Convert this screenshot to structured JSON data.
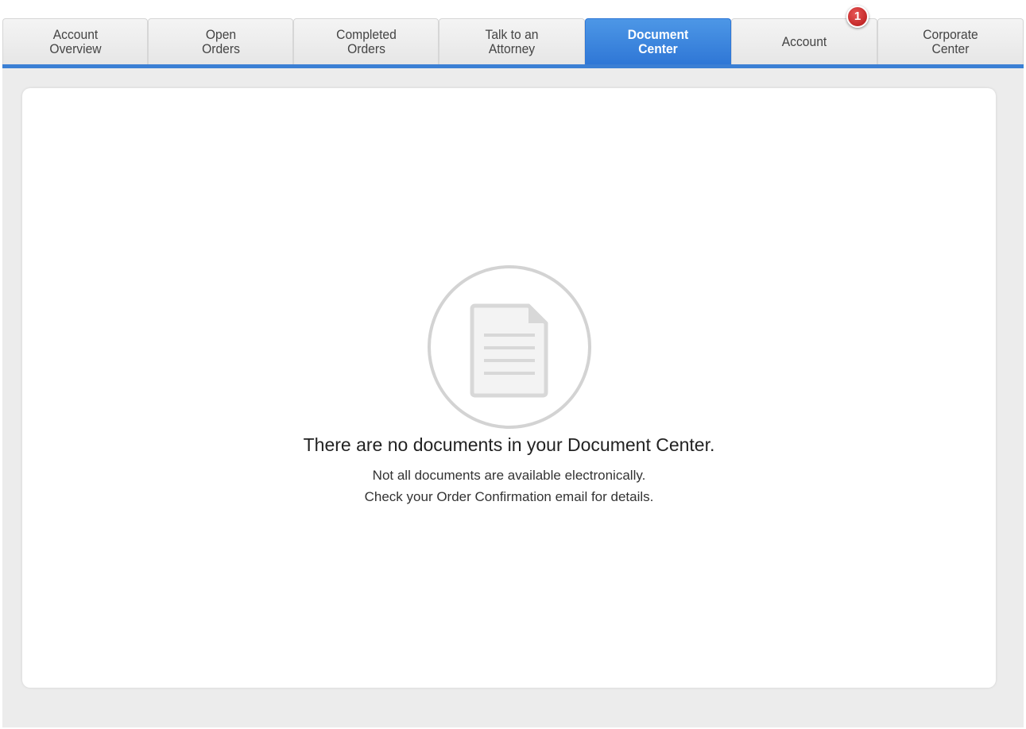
{
  "tabs": [
    {
      "label": "Account\nOverview",
      "active": false
    },
    {
      "label": "Open\nOrders",
      "active": false
    },
    {
      "label": "Completed\nOrders",
      "active": false
    },
    {
      "label": "Talk to an\nAttorney",
      "active": false
    },
    {
      "label": "Document\nCenter",
      "active": true
    },
    {
      "label": "Account",
      "active": false
    },
    {
      "label": "Corporate\nCenter",
      "active": false
    }
  ],
  "notification": {
    "count": "1",
    "color": "#c62020"
  },
  "empty_state": {
    "icon": "document-icon",
    "title": "There are no documents in your Document Center.",
    "line1": "Not all documents are available electronically.",
    "line2": "Check your Order Confirmation email for details."
  },
  "colors": {
    "accent": "#3b7fd4",
    "active_tab": "#3a85dc",
    "background": "#ececec"
  }
}
